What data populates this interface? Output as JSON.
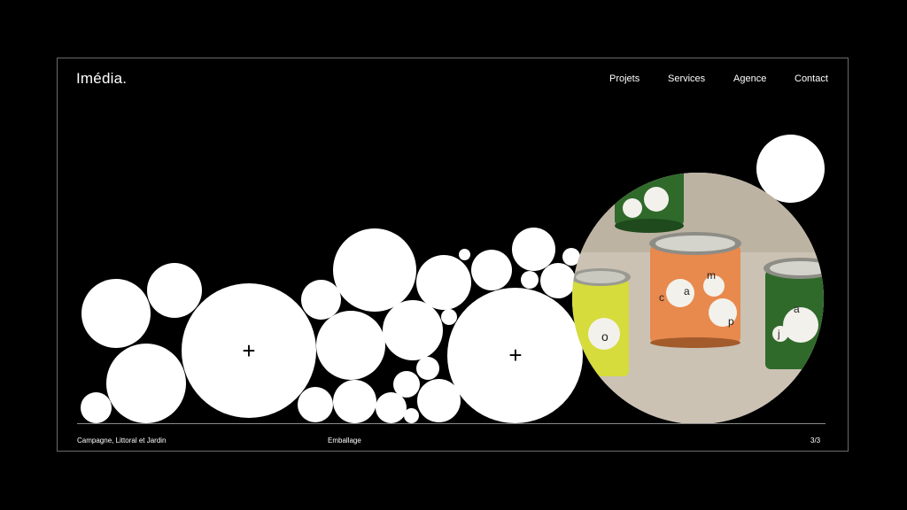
{
  "brand": {
    "logo": "Imédia."
  },
  "nav": {
    "items": [
      "Projets",
      "Services",
      "Agence",
      "Contact"
    ]
  },
  "hero": {
    "plus_left": "+",
    "plus_right": "+",
    "photo_subject": "paint-cans-packaging",
    "label_letters": [
      "c",
      "a",
      "m",
      "p",
      "o",
      "j",
      "a"
    ]
  },
  "footer": {
    "project": "Campagne, Littoral et Jardin",
    "category": "Emballage",
    "pagination": "3/3"
  },
  "colors": {
    "background": "#000000",
    "text": "#ffffff",
    "border": "#6b6b6b",
    "orange_label": "#e8894e",
    "green_label": "#2e6b2c",
    "yellow_label": "#d9e03a"
  }
}
